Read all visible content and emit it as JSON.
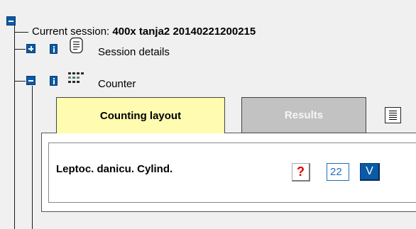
{
  "session": {
    "label_prefix": "Current session:",
    "name": "400x tanja2 20140221200215"
  },
  "tree": {
    "session_details_label": "Session details",
    "counter_label": "Counter"
  },
  "tabs": [
    {
      "label": "Counting layout",
      "active": true
    },
    {
      "label": "Results",
      "active": false
    }
  ],
  "counter": {
    "item_name": "Leptoc. danicu. Cylind.",
    "help_symbol": "?",
    "count_value": "22",
    "confirm_label": "V"
  },
  "colors": {
    "accent_blue": "#0b5aa6",
    "active_tab": "#fffbb0",
    "inactive_tab": "#c2c2c2",
    "help_red": "#e00000"
  },
  "icons": [
    "collapse-icon",
    "expand-icon",
    "info-icon",
    "document-icon",
    "counter-icon",
    "list-menu-icon",
    "help-icon"
  ]
}
